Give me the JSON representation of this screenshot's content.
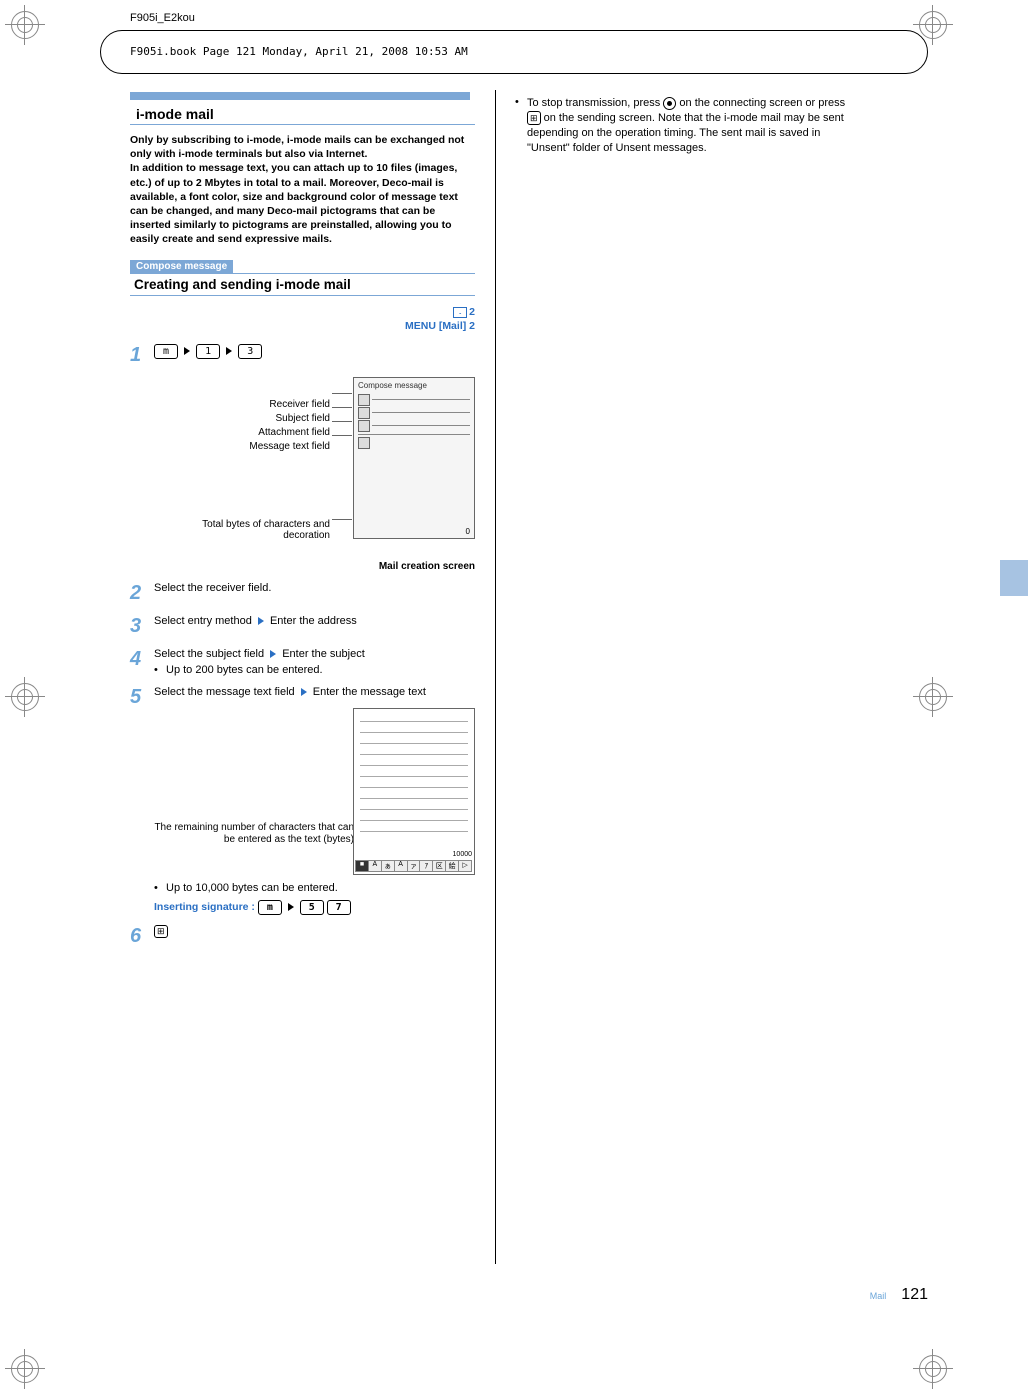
{
  "doc_header": "F905i_E2kou",
  "book_info": "F905i.book  Page 121  Monday, April 21, 2008  10:53 AM",
  "section_title": "i-mode mail",
  "intro": "Only by subscribing to i-mode, i-mode mails can be exchanged not only with i-mode terminals but also via Internet.\nIn addition to message text, you can attach up to 10 files (images, etc.) of up to 2 Mbytes in total to a mail. Moreover, Deco-mail is available, a font color, size and background color of message text can be changed, and many Deco-mail pictograms that can be inserted similarly to pictograms are preinstalled, allowing you to easily create and send expressive mails.",
  "compose_label": "Compose message",
  "compose_title": "Creating and sending i-mode mail",
  "menu_path_line1": "2",
  "menu_path_line2": "MENU [Mail] 2",
  "steps": {
    "s1_keys": [
      "m",
      "1",
      "3"
    ],
    "screen1_title": "Compose message",
    "labels": {
      "receiver": "Receiver field",
      "subject": "Subject field",
      "attach": "Attachment field",
      "msg": "Message text field",
      "total": "Total bytes of characters and decoration"
    },
    "screen1_caption": "Mail creation screen",
    "s2": "Select the receiver field.",
    "s3": "Select entry method ▶ Enter the address",
    "s3_a": "Select entry method",
    "s3_b": "Enter the address",
    "s4_a": "Select the subject field",
    "s4_b": "Enter the subject",
    "s4_note": "Up to 200 bytes can be entered.",
    "s5_a": "Select the message text field",
    "s5_b": "Enter the message text",
    "s5_label": "The remaining number of characters that can be entered as the text (bytes)",
    "s5_count": "10000",
    "s5_note": "Up to 10,000 bytes can be entered.",
    "ins_sig": "Inserting signature :",
    "ins_keys": [
      "m",
      "5",
      "7"
    ]
  },
  "right_bullet": "To stop transmission, press ● on the connecting screen or press 〓 on the sending screen. Note that the i-mode mail may be sent depending on the operation timing. The sent mail is saved in \"Unsent\" folder of Unsent messages.",
  "footer": {
    "section": "Mail",
    "page": "121"
  }
}
